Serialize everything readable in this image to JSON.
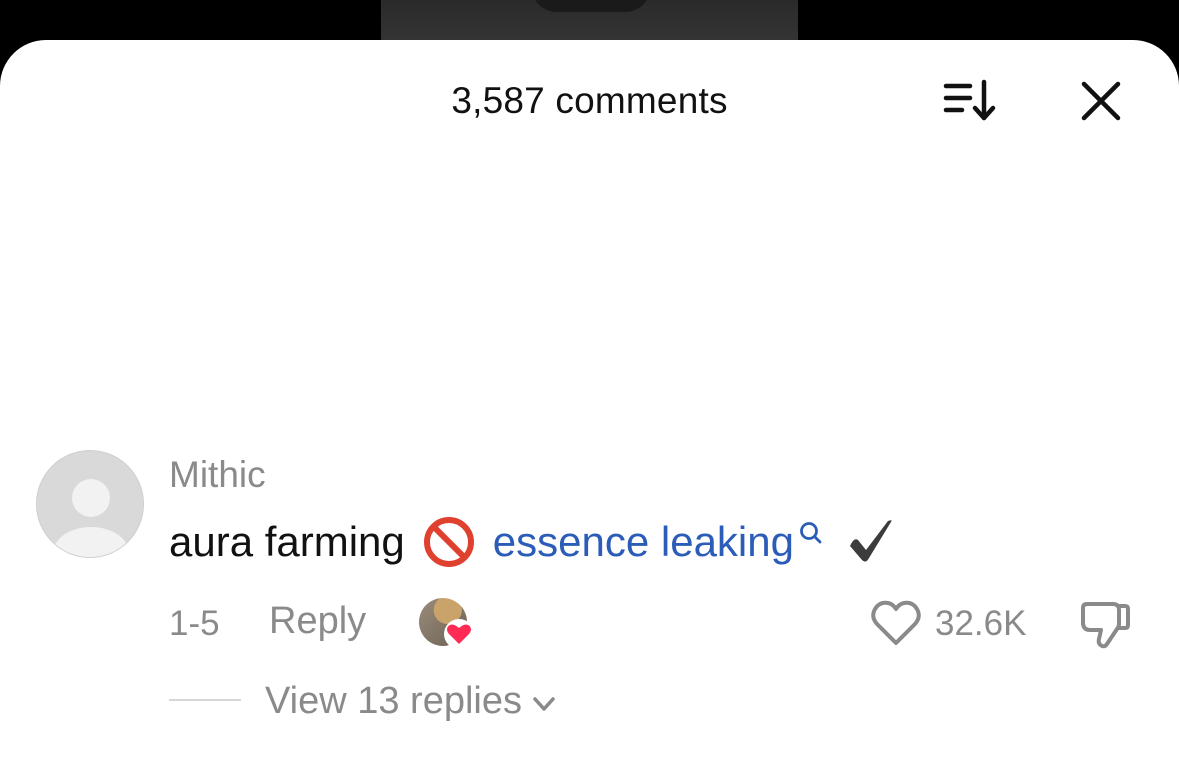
{
  "header": {
    "title": "3,587 comments"
  },
  "comment": {
    "username": "Mithic",
    "text_before": "aura farming",
    "link_text": "essence leaking",
    "date": "1-5",
    "reply_label": "Reply",
    "like_count": "32.6K"
  },
  "replies": {
    "label": "View 13 replies"
  },
  "colors": {
    "link": "#2b5cb8",
    "muted_text": "#8a8a8a",
    "heart": "#fe2c55"
  },
  "icons": [
    "sort-icon",
    "close-icon",
    "no-entry-icon",
    "search-icon",
    "check-mark-icon",
    "heart-outline-icon",
    "thumbs-down-icon",
    "chevron-down-icon",
    "heart-badge-icon"
  ]
}
